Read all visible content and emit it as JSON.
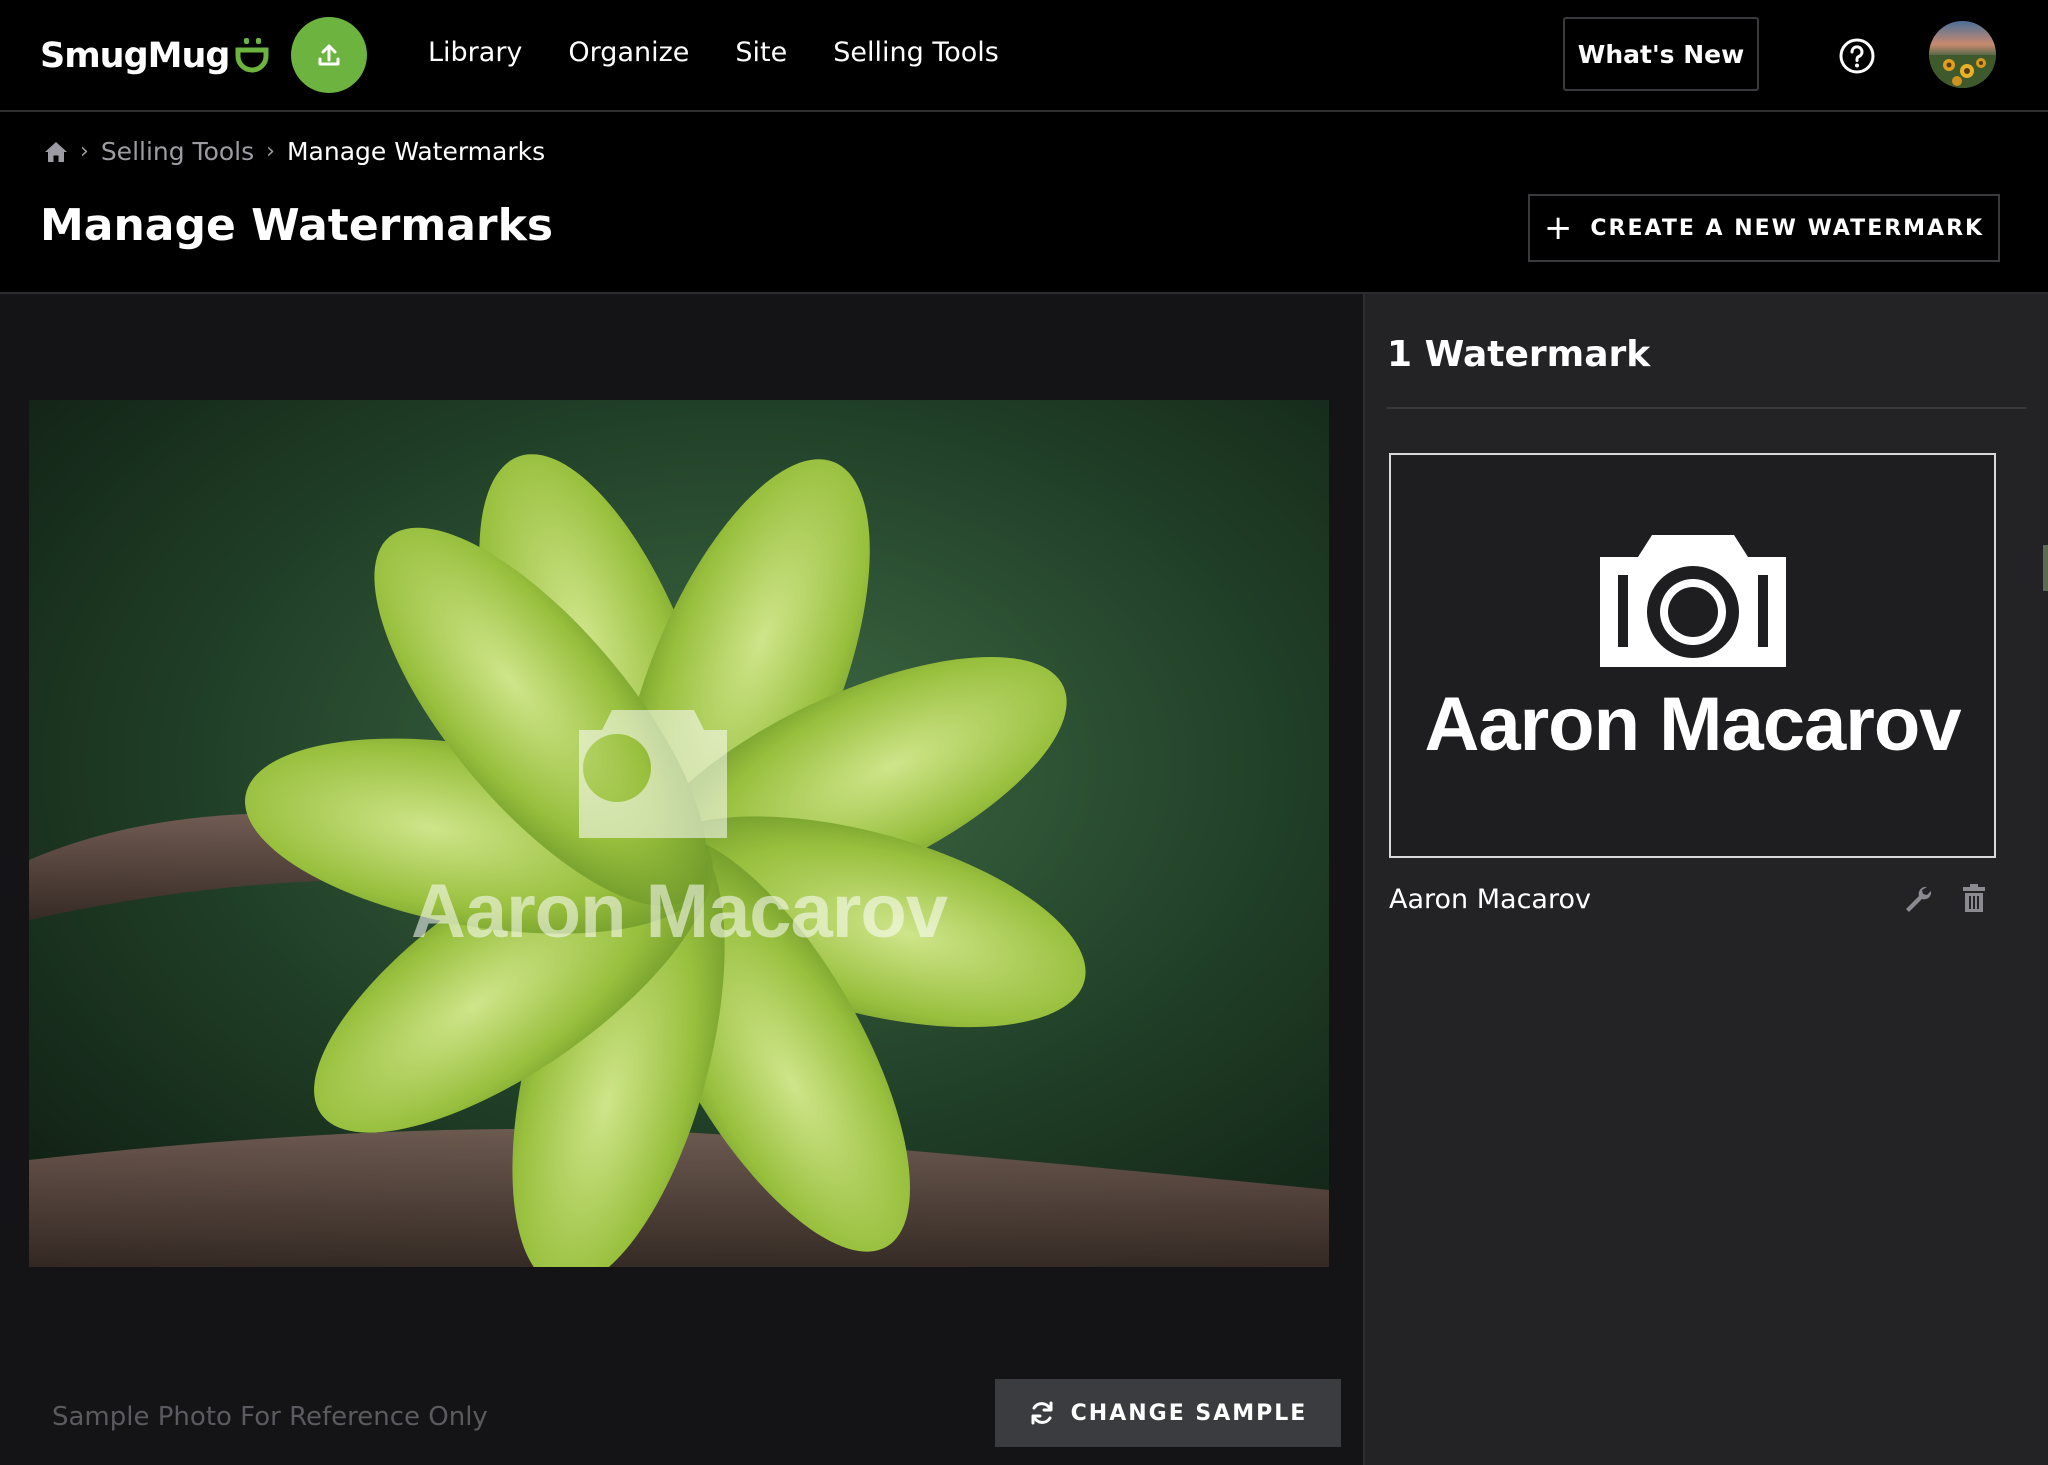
{
  "nav": {
    "brand": "SmugMug",
    "links": [
      "Library",
      "Organize",
      "Site",
      "Selling Tools"
    ],
    "whats_new": "What's New",
    "upload_icon": "upload-icon",
    "help_icon": "question-circle-icon"
  },
  "breadcrumb": {
    "home_icon": "home-icon",
    "parent": "Selling Tools",
    "current": "Manage Watermarks"
  },
  "page": {
    "title": "Manage Watermarks",
    "create_button": "CREATE A NEW WATERMARK"
  },
  "preview": {
    "watermark_overlay_text": "Aaron Macarov",
    "note": "Sample Photo For Reference Only",
    "change_button": "CHANGE SAMPLE"
  },
  "panel": {
    "count_label": "1 Watermark",
    "watermarks": [
      {
        "card_text": "Aaron Macarov",
        "name": "Aaron Macarov",
        "actions": [
          "wrench-icon",
          "trash-icon"
        ]
      }
    ]
  },
  "colors": {
    "accent_green": "#6db33f",
    "background": "#141416",
    "panel": "#232326",
    "topbar": "#000000"
  }
}
